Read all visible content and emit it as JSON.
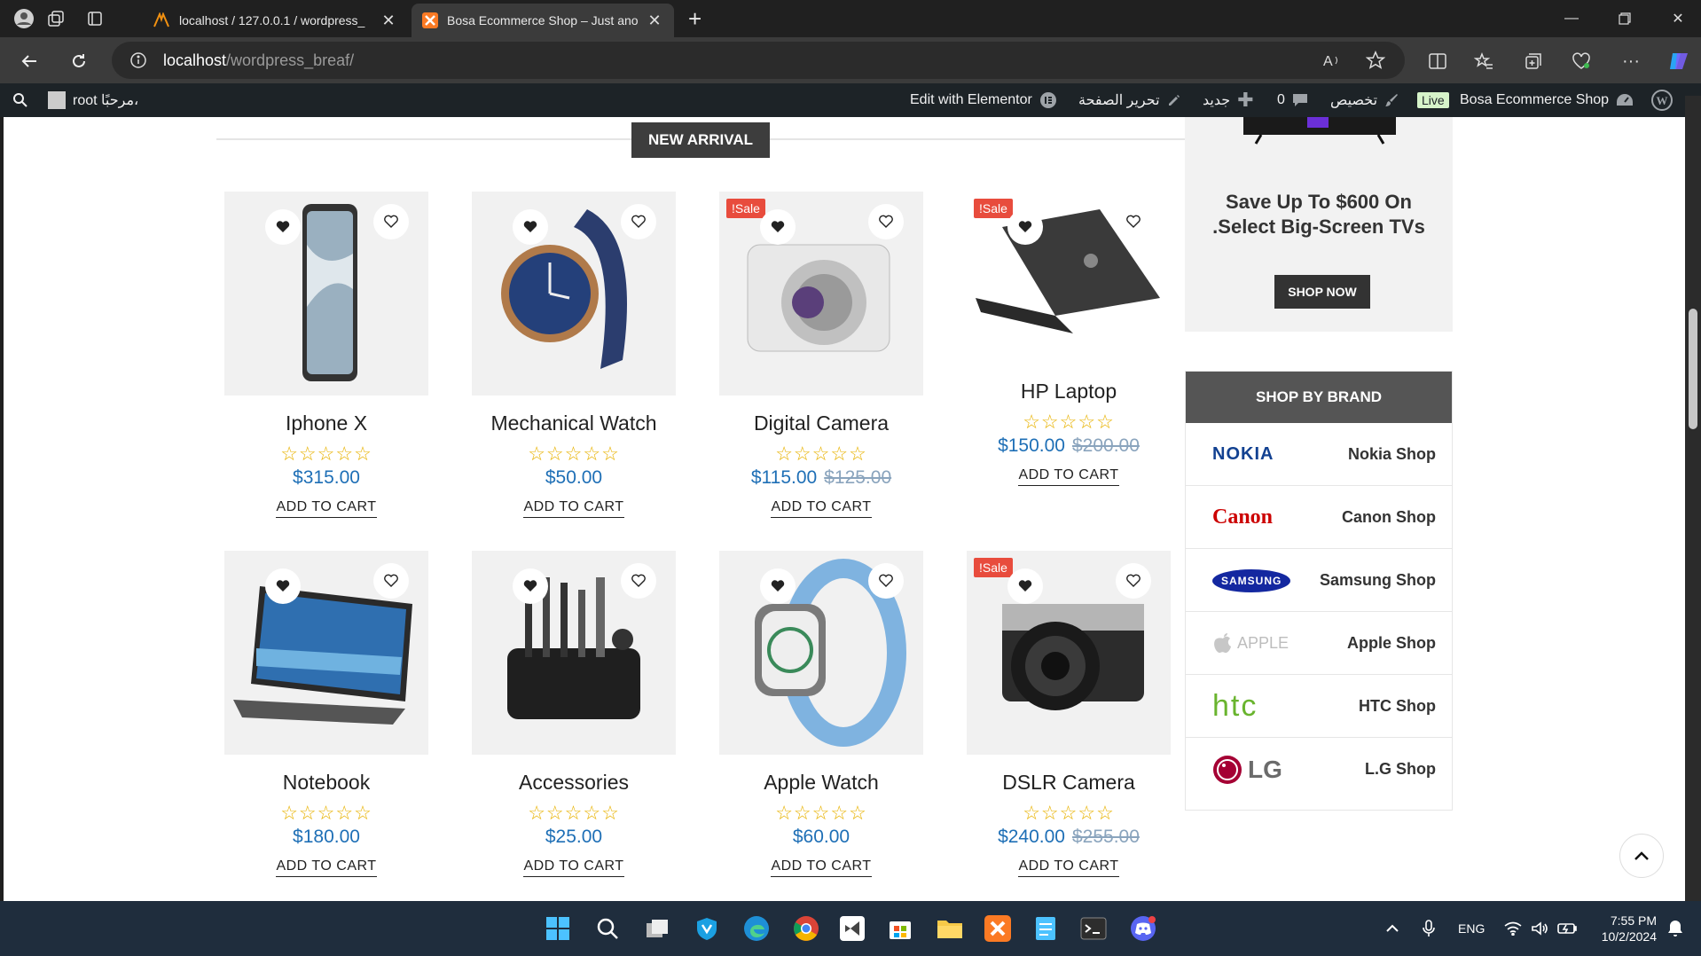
{
  "browser": {
    "tabs": [
      {
        "title": "localhost / 127.0.0.1 / wordpress_"
      },
      {
        "title": "Bosa Ecommerce Shop – Just ano"
      }
    ],
    "address": {
      "host": "localhost",
      "path": "/wordpress_breaf/"
    }
  },
  "wp_admin": {
    "greeting": "root مرحبًا،",
    "edit_elementor": "Edit with Elementor",
    "edit_page": "تحرير الصفحة",
    "new": "جديد",
    "comments": "0",
    "customize": "تخصيص",
    "live": "Live",
    "site": "Bosa Ecommerce Shop"
  },
  "section": {
    "title": "NEW ARRIVAL"
  },
  "products": [
    {
      "name": "Iphone X",
      "price": "$315.00",
      "old_price": "",
      "sale": "",
      "add": "ADD TO CART"
    },
    {
      "name": "Mechanical Watch",
      "price": "$50.00",
      "old_price": "",
      "sale": "",
      "add": "ADD TO CART"
    },
    {
      "name": "Digital Camera",
      "price": "$115.00",
      "old_price": "$125.00",
      "sale": "!Sale",
      "add": "ADD TO CART"
    },
    {
      "name": "HP Laptop",
      "price": "$150.00",
      "old_price": "$200.00",
      "sale": "!Sale",
      "add": "ADD TO CART"
    },
    {
      "name": "Notebook",
      "price": "$180.00",
      "old_price": "",
      "sale": "",
      "add": "ADD TO CART"
    },
    {
      "name": "Accessories",
      "price": "$25.00",
      "old_price": "",
      "sale": "",
      "add": "ADD TO CART"
    },
    {
      "name": "Apple Watch",
      "price": "$60.00",
      "old_price": "",
      "sale": "",
      "add": "ADD TO CART"
    },
    {
      "name": "DSLR Camera",
      "price": "$240.00",
      "old_price": "$255.00",
      "sale": "!Sale",
      "add": "ADD TO CART"
    }
  ],
  "rating": "☆☆☆☆☆",
  "promo": {
    "line1": "Save Up To $600 On",
    "line2": ".Select Big-Screen TVs",
    "button": "SHOP NOW"
  },
  "brands": {
    "title": "SHOP BY BRAND",
    "items": [
      {
        "logo": "NOKIA",
        "name": "Nokia Shop",
        "color": "#124191"
      },
      {
        "logo": "Canon",
        "name": "Canon Shop",
        "color": "#cc0000"
      },
      {
        "logo": "SAMSUNG",
        "name": "Samsung Shop",
        "color": "#1428a0"
      },
      {
        "logo": "APPLE",
        "name": "Apple Shop",
        "color": "#bdbdbd"
      },
      {
        "logo": "htc",
        "name": "HTC Shop",
        "color": "#69b42e"
      },
      {
        "logo": "LG",
        "name": "L.G Shop",
        "color": "#a50034"
      }
    ]
  },
  "taskbar": {
    "lang": "ENG",
    "time": "7:55 PM",
    "date": "10/2/2024"
  }
}
